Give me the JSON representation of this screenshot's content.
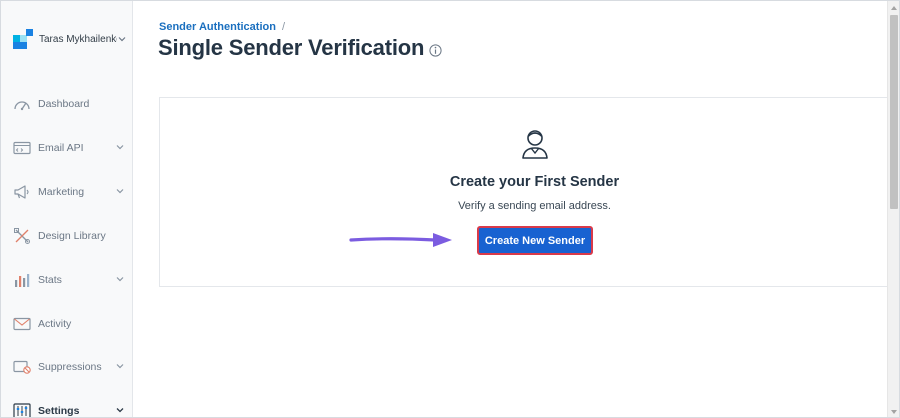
{
  "sidebar": {
    "account_name": "Taras Mykhailenko",
    "logo_colors": [
      "#1a82e2",
      "#00b2e3",
      "#99e1f4",
      "#263746"
    ],
    "items": [
      {
        "label": "Dashboard",
        "icon": "dashboard-icon",
        "has_caret": false
      },
      {
        "label": "Email API",
        "icon": "email-api-icon",
        "has_caret": true
      },
      {
        "label": "Marketing",
        "icon": "megaphone-icon",
        "has_caret": true
      },
      {
        "label": "Design Library",
        "icon": "design-library-icon",
        "has_caret": false
      },
      {
        "label": "Stats",
        "icon": "stats-icon",
        "has_caret": true
      },
      {
        "label": "Activity",
        "icon": "activity-envelope-icon",
        "has_caret": false
      },
      {
        "label": "Suppressions",
        "icon": "suppressions-icon",
        "has_caret": true
      },
      {
        "label": "Settings",
        "icon": "settings-icon",
        "has_caret": true,
        "active": true
      }
    ]
  },
  "breadcrumb": {
    "parent": "Sender Authentication",
    "separator": "/"
  },
  "page": {
    "title": "Single Sender Verification"
  },
  "empty_state": {
    "icon": "sender-person-icon",
    "title": "Create your First Sender",
    "subtitle": "Verify a sending email address.",
    "button_label": "Create New Sender"
  },
  "colors": {
    "accent": "#1862d1",
    "button_outline": "#d93a4a",
    "annotation_arrow": "#7b5ce0",
    "link": "#1a6fbf"
  }
}
